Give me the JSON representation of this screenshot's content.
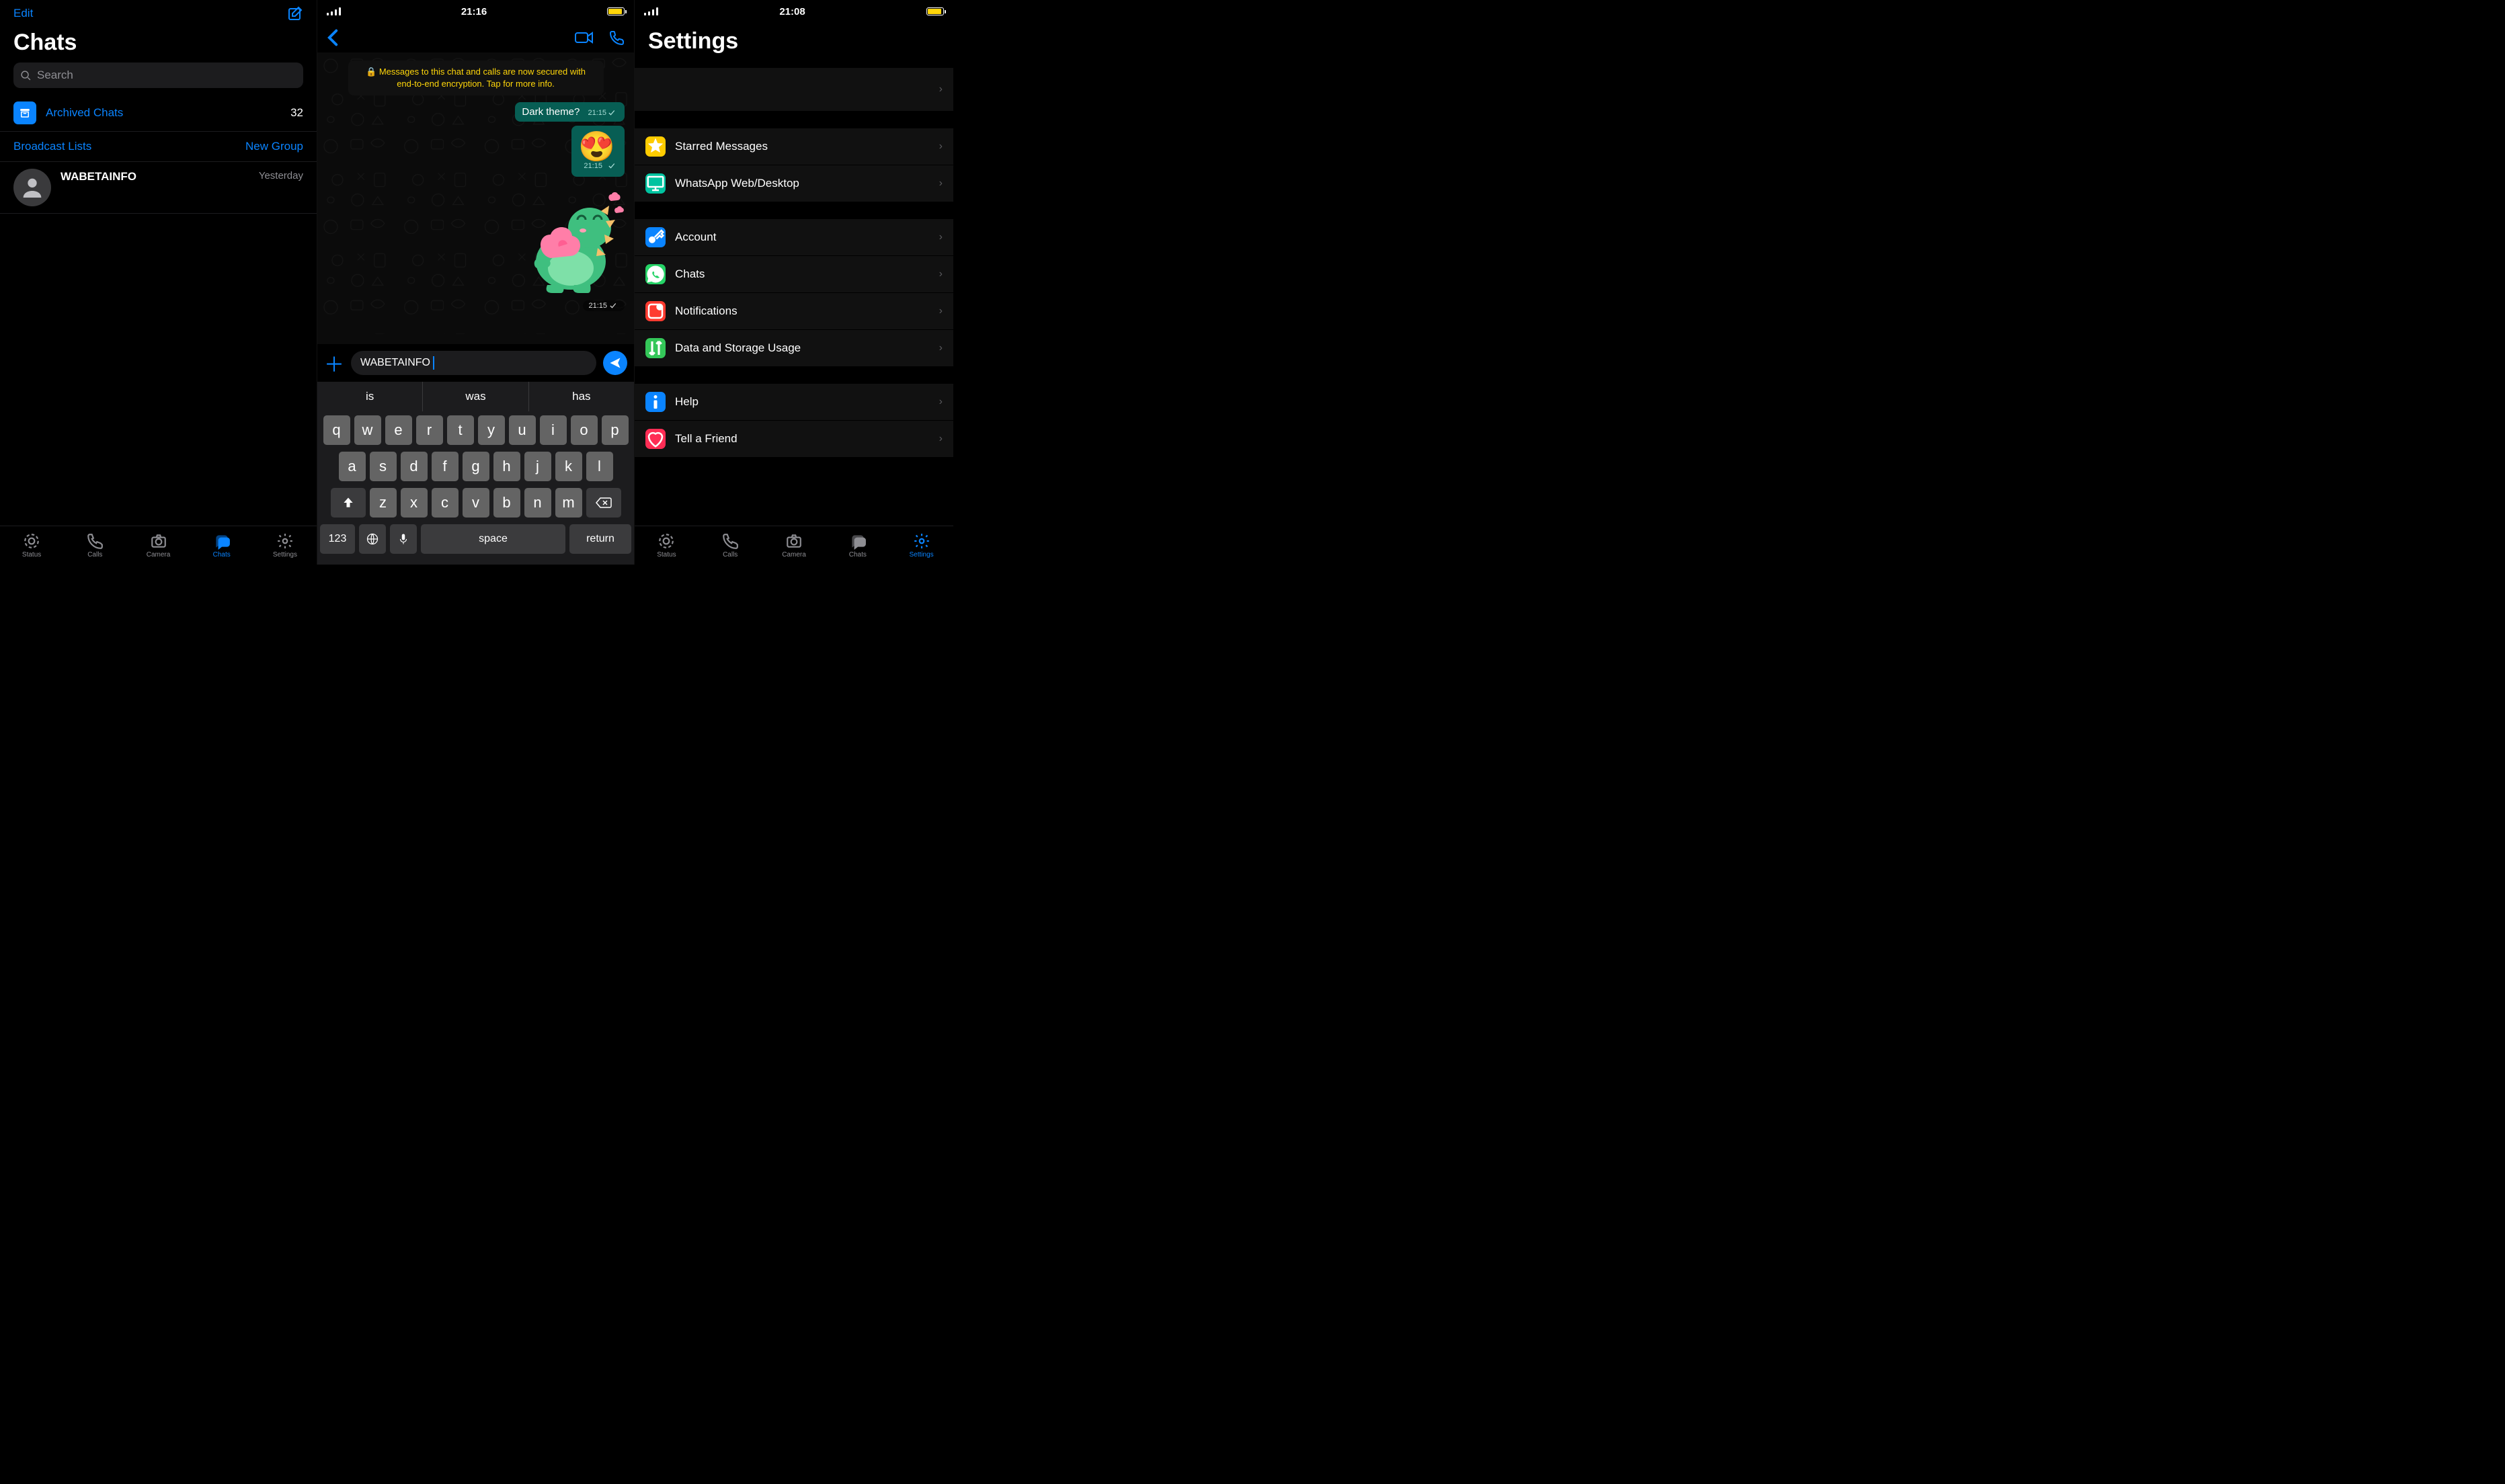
{
  "panel1": {
    "edit": "Edit",
    "title": "Chats",
    "search_placeholder": "Search",
    "archived_label": "Archived Chats",
    "archived_count": "32",
    "broadcast": "Broadcast Lists",
    "new_group": "New Group",
    "chat": {
      "name": "WABETAINFO",
      "time": "Yesterday"
    },
    "tabs": [
      "Status",
      "Calls",
      "Camera",
      "Chats",
      "Settings"
    ],
    "active_tab": 3
  },
  "panel2": {
    "status_time": "21:16",
    "encryption_notice": "Messages to this chat and calls are now secured with end-to-end encryption. Tap for more info.",
    "msg1": {
      "text": "Dark theme?",
      "time": "21:15"
    },
    "msg2": {
      "time": "21:15"
    },
    "msg3": {
      "time": "21:15"
    },
    "input_value": "WABETAINFO",
    "suggestions": [
      "is",
      "was",
      "has"
    ],
    "keyboard": {
      "row1": [
        "q",
        "w",
        "e",
        "r",
        "t",
        "y",
        "u",
        "i",
        "o",
        "p"
      ],
      "row2": [
        "a",
        "s",
        "d",
        "f",
        "g",
        "h",
        "j",
        "k",
        "l"
      ],
      "row3": [
        "z",
        "x",
        "c",
        "v",
        "b",
        "n",
        "m"
      ],
      "numkey": "123",
      "space": "space",
      "return": "return"
    },
    "battery_pct": 90
  },
  "panel3": {
    "status_time": "21:08",
    "title": "Settings",
    "group1": [
      {
        "label": "Starred Messages",
        "color": "#ffcc00",
        "icon": "star"
      },
      {
        "label": "WhatsApp Web/Desktop",
        "color": "#00c3a0",
        "icon": "desktop"
      }
    ],
    "group2": [
      {
        "label": "Account",
        "color": "#0a84ff",
        "icon": "key"
      },
      {
        "label": "Chats",
        "color": "#25d366",
        "icon": "whatsapp"
      },
      {
        "label": "Notifications",
        "color": "#ff3b30",
        "icon": "bell"
      },
      {
        "label": "Data and Storage Usage",
        "color": "#34c759",
        "icon": "arrows"
      }
    ],
    "group3": [
      {
        "label": "Help",
        "color": "#0a84ff",
        "icon": "info"
      },
      {
        "label": "Tell a Friend",
        "color": "#ff2d55",
        "icon": "heart"
      }
    ],
    "tabs": [
      "Status",
      "Calls",
      "Camera",
      "Chats",
      "Settings"
    ],
    "active_tab": 4,
    "battery_pct": 90
  }
}
